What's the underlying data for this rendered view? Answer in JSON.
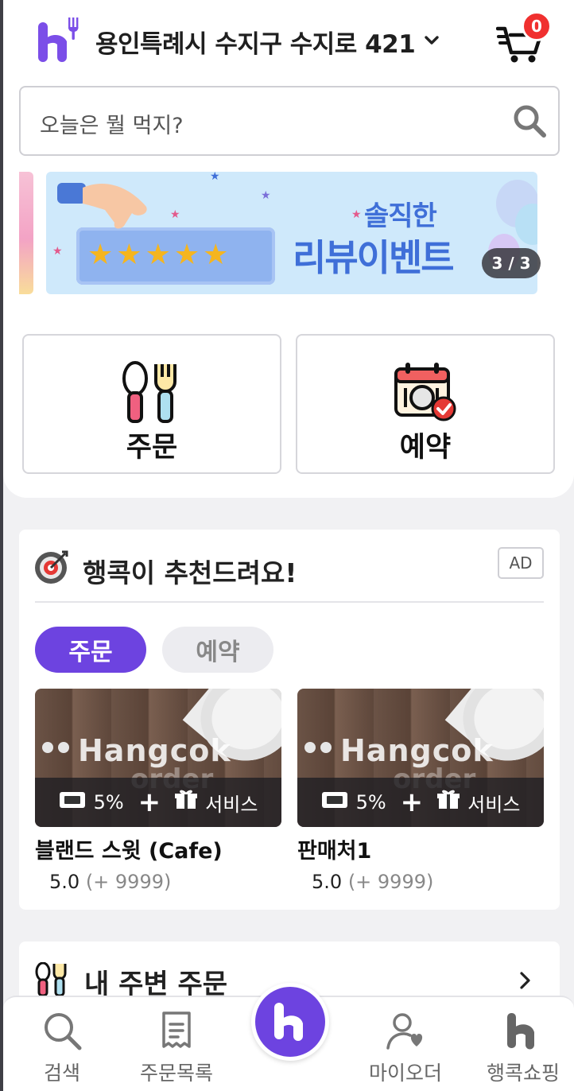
{
  "header": {
    "address": "용인특례시 수지구 수지로 421",
    "cart_count": "0",
    "icons": {
      "logo": "hangcok-logo",
      "chevron": "chevron-down-icon",
      "cart": "cart-icon"
    }
  },
  "search": {
    "placeholder": "오늘은 뭘 먹지?",
    "icon": "search-icon"
  },
  "banner": {
    "line1": "솔직한",
    "line2": "리뷰이벤트",
    "pager": "3 / 3"
  },
  "service_tiles": [
    {
      "label": "주문",
      "icon": "spoon-fork-icon"
    },
    {
      "label": "예약",
      "icon": "calendar-dish-icon"
    }
  ],
  "recommend": {
    "title": "행콕이 추천드려요!",
    "ad_label": "AD",
    "tabs": [
      {
        "label": "주문",
        "active": true
      },
      {
        "label": "예약",
        "active": false
      }
    ],
    "stores": [
      {
        "name": "블랜드 스윗 (Cafe)",
        "coupon": "5%",
        "plus": "+",
        "service": "서비스",
        "rating": "5.0",
        "review_count": "(+ 9999)",
        "image_text_1": "Hangcok",
        "image_text_2": "order"
      },
      {
        "name": "판매처1",
        "coupon": "5%",
        "plus": "+",
        "service": "서비스",
        "rating": "5.0",
        "review_count": "(+ 9999)",
        "image_text_1": "Hangcok",
        "image_text_2": "order"
      }
    ]
  },
  "nearby": {
    "title": "내 주변 주문"
  },
  "bottom_nav": [
    {
      "label": "검색",
      "icon": "search-icon"
    },
    {
      "label": "주문목록",
      "icon": "receipt-icon"
    },
    {
      "label": "",
      "icon": "hangcok-home-icon"
    },
    {
      "label": "마이오더",
      "icon": "user-heart-icon"
    },
    {
      "label": "행콕쇼핑",
      "icon": "hangcok-shop-icon"
    }
  ],
  "colors": {
    "accent": "#6d43e0",
    "badge": "#f0302f",
    "banner_text": "#3f6fd8",
    "star": "#f5b51f"
  }
}
